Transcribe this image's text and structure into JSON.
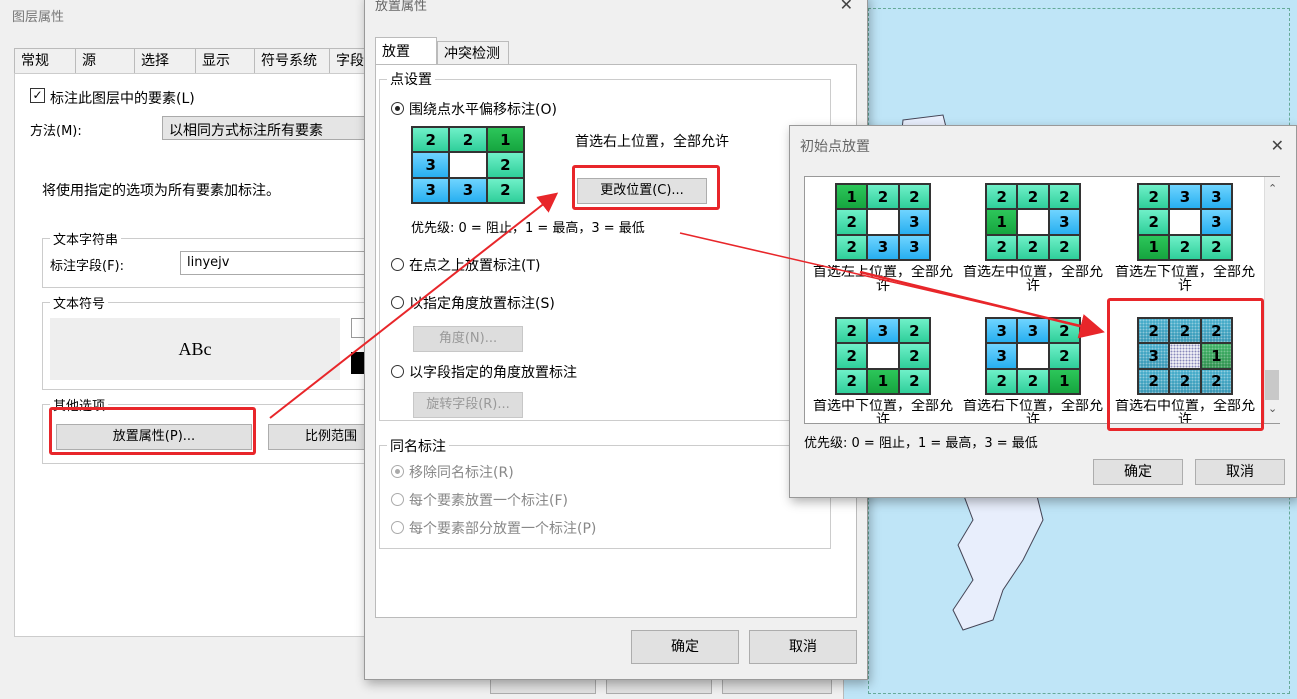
{
  "layer_window": {
    "title": "图层属性",
    "tabs": [
      "常规",
      "源",
      "选择",
      "显示",
      "符号系统",
      "字段"
    ],
    "label_checkbox": "标注此图层中的要素(L)",
    "method_label": "方法(M):",
    "method_value": "以相同方式标注所有要素",
    "info_text": "将使用指定的选项为所有要素加标注。",
    "text_string_group": "文本字符串",
    "label_field_label": "标注字段(F):",
    "label_field_value": "linyejv",
    "text_symbol_group": "文本符号",
    "symbol_preview": "ABc",
    "other_options_group": "其他选项",
    "placement_button": "放置属性(P)...",
    "scale_button": "比例范围"
  },
  "placement_dialog": {
    "title": "放置属性",
    "tabs": [
      "放置",
      "冲突检测"
    ],
    "point_group": "点设置",
    "radio_offset": "围绕点水平偏移标注(O)",
    "grid": [
      [
        "2",
        "2",
        "1"
      ],
      [
        "3",
        "",
        "2"
      ],
      [
        "3",
        "3",
        "2"
      ]
    ],
    "grid_colors": [
      [
        "c2",
        "c2",
        "c1"
      ],
      [
        "c3",
        "c0",
        "c2"
      ],
      [
        "c3",
        "c3",
        "c2"
      ]
    ],
    "selected_desc": "首选右上位置，全部允许",
    "change_button": "更改位置(C)...",
    "priority_text": "优先级: 0 = 阻止，1 = 最高，3 = 最低",
    "radio_top": "在点之上放置标注(T)",
    "radio_angle": "以指定角度放置标注(S)",
    "angle_button": "角度(N)...",
    "radio_field_angle": "以字段指定的角度放置标注",
    "rotate_button": "旋转字段(R)...",
    "dup_group": "同名标注",
    "dup_remove": "移除同名标注(R)",
    "dup_each_feature": "每个要素放置一个标注(F)",
    "dup_each_part": "每个要素部分放置一个标注(P)",
    "ok": "确定",
    "cancel": "取消"
  },
  "initial_dialog": {
    "title": "初始点放置",
    "options": [
      {
        "caption": "首选左上位置，全部允许",
        "grid": [
          [
            "1",
            "2",
            "2"
          ],
          [
            "2",
            "",
            "3"
          ],
          [
            "2",
            "3",
            "3"
          ]
        ],
        "colors": [
          [
            "c1",
            "c2",
            "c2"
          ],
          [
            "c2",
            "c0",
            "c3"
          ],
          [
            "c2",
            "c3",
            "c3"
          ]
        ]
      },
      {
        "caption": "首选左中位置，全部允许",
        "grid": [
          [
            "2",
            "2",
            "2"
          ],
          [
            "1",
            "",
            "3"
          ],
          [
            "2",
            "2",
            "2"
          ]
        ],
        "colors": [
          [
            "c2",
            "c2",
            "c2"
          ],
          [
            "c1",
            "c0",
            "c3"
          ],
          [
            "c2",
            "c2",
            "c2"
          ]
        ]
      },
      {
        "caption": "首选左下位置，全部允许",
        "grid": [
          [
            "2",
            "3",
            "3"
          ],
          [
            "2",
            "",
            "3"
          ],
          [
            "1",
            "2",
            "2"
          ]
        ],
        "colors": [
          [
            "c2",
            "c3",
            "c3"
          ],
          [
            "c2",
            "c0",
            "c3"
          ],
          [
            "c1",
            "c2",
            "c2"
          ]
        ]
      },
      {
        "caption": "首选中下位置，全部允许",
        "grid": [
          [
            "2",
            "3",
            "2"
          ],
          [
            "2",
            "",
            "2"
          ],
          [
            "2",
            "1",
            "2"
          ]
        ],
        "colors": [
          [
            "c2",
            "c3",
            "c2"
          ],
          [
            "c2",
            "c0",
            "c2"
          ],
          [
            "c2",
            "c1",
            "c2"
          ]
        ]
      },
      {
        "caption": "首选右下位置，全部允许",
        "grid": [
          [
            "3",
            "3",
            "2"
          ],
          [
            "3",
            "",
            "2"
          ],
          [
            "2",
            "2",
            "1"
          ]
        ],
        "colors": [
          [
            "c3",
            "c3",
            "c2"
          ],
          [
            "c3",
            "c0",
            "c2"
          ],
          [
            "c2",
            "c2",
            "c1"
          ]
        ]
      },
      {
        "caption": "首选右中位置，全部允许",
        "grid": [
          [
            "2",
            "2",
            "2"
          ],
          [
            "3",
            "",
            "1"
          ],
          [
            "2",
            "2",
            "2"
          ]
        ],
        "colors": [
          [
            "c2",
            "c2",
            "c2"
          ],
          [
            "c3",
            "c0",
            "c1"
          ],
          [
            "c2",
            "c2",
            "c2"
          ]
        ]
      }
    ],
    "priority_text": "优先级: 0 = 阻止，1 = 最高，3 = 最低",
    "ok": "确定",
    "cancel": "取消"
  },
  "colors": {
    "highlight_red": "#e8262a",
    "map_water": "#bfe5f7",
    "map_land": "#e8eefc"
  }
}
